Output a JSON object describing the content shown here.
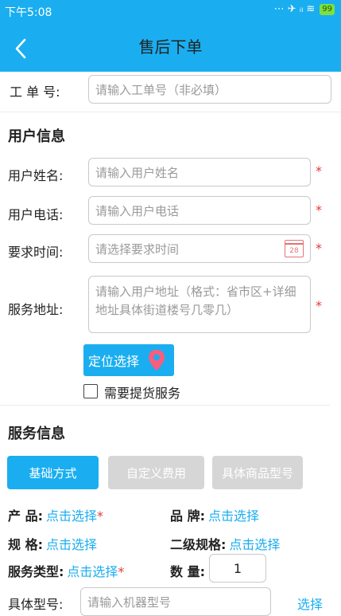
{
  "status_bar": {
    "time": "下午5:08",
    "icons": "⋯ ✈ ᵢₗ ≋",
    "battery": "99"
  },
  "header": {
    "title": "售后下单",
    "back_icon": "chevron-left-icon"
  },
  "order": {
    "label": "工 单 号:",
    "placeholder": "请输入工单号（非必填）"
  },
  "user_info": {
    "section_title": "用户信息",
    "name": {
      "label": "用户姓名:",
      "placeholder": "请输入用户姓名",
      "required": "*"
    },
    "phone": {
      "label": "用户电话:",
      "placeholder": "请输入用户电话",
      "required": "*"
    },
    "time": {
      "label": "要求时间:",
      "placeholder": "请选择要求时间",
      "required": "*",
      "calendar_day": "28"
    },
    "address": {
      "label": "服务地址:",
      "placeholder": "请输入用户地址（格式：省市区+详细地址具体街道楼号几零几）",
      "required": "*"
    },
    "locate_button": "定位选择",
    "pickup_label": "需要提货服务"
  },
  "service_info": {
    "section_title": "服务信息",
    "tabs": [
      "基础方式",
      "自定义费用",
      "具体商品型号"
    ],
    "product_key": "产 品:",
    "product_value": "点击选择",
    "product_required": "*",
    "brand_key": "品 牌:",
    "brand_value": "点击选择",
    "spec_key": "规 格:",
    "spec_value": "点击选择",
    "spec2_key": "二级规格:",
    "spec2_value": "点击选择",
    "service_type_key": "服务类型:",
    "service_type_value": "点击选择",
    "service_type_required": "*",
    "quantity_key": "数 量:",
    "quantity_value": "1",
    "model_key": "具体型号:",
    "model_placeholder": "请输入机器型号",
    "model_select": "选择"
  },
  "colors": {
    "accent": "#1aaef0",
    "required": "#e53935",
    "disabled_tab": "#d6d6d6"
  }
}
